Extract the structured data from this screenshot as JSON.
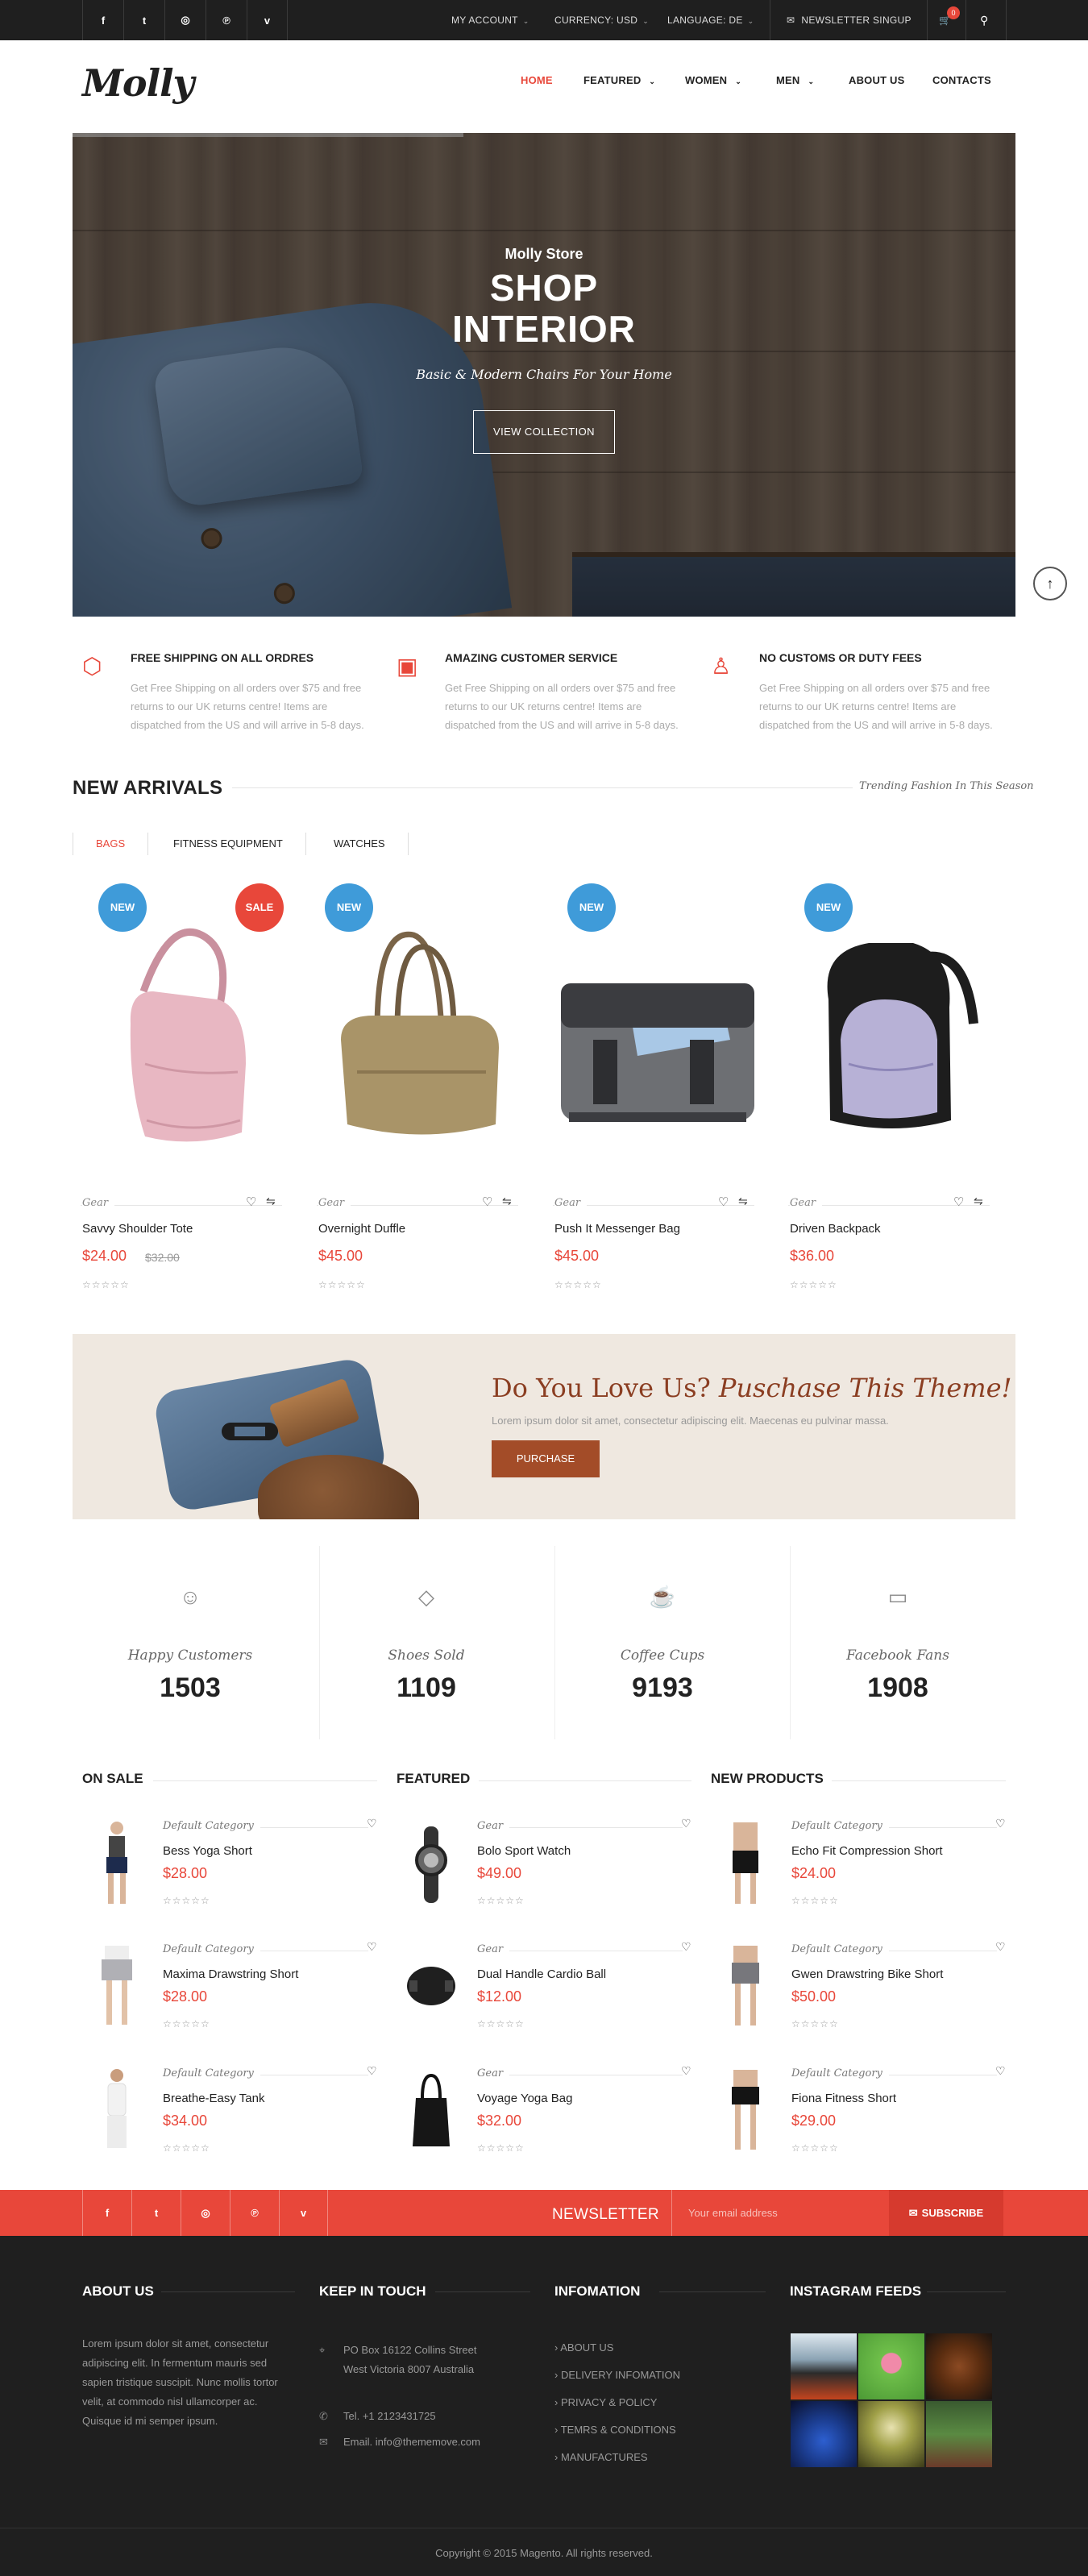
{
  "topbar": {
    "social": [
      "f",
      "t",
      "◎",
      "℗",
      "v"
    ],
    "account": "MY ACCOUNT",
    "currency": "CURRENCY: USD",
    "language": "LANGUAGE: DE",
    "newsletter": "NEWSLETTER SINGUP",
    "cart_count": "0"
  },
  "header": {
    "logo": "Molly",
    "nav": [
      "HOME",
      "FEATURED",
      "WOMEN",
      "MEN",
      "ABOUT US",
      "CONTACTS"
    ]
  },
  "hero": {
    "subtitle": "Molly Store",
    "title_line1": "SHOP",
    "title_line2": "INTERIOR",
    "tagline": "Basic & Modern Chairs For Your Home",
    "button": "VIEW COLLECTION"
  },
  "features": [
    {
      "title": "FREE SHIPPING ON ALL ORDRES",
      "desc": "Get Free Shipping on all orders over $75 and free returns to our UK returns centre! Items are dispatched from the US and will arrive in 5-8 days.",
      "icon": "box-icon"
    },
    {
      "title": "AMAZING CUSTOMER SERVICE",
      "desc": "Get Free Shipping on all orders over $75 and free returns to our UK returns centre! Items are dispatched from the US and will arrive in 5-8 days.",
      "icon": "wallet-icon"
    },
    {
      "title": "NO CUSTOMS OR DUTY FEES",
      "desc": "Get Free Shipping on all orders over $75 and free returns to our UK returns centre! Items are dispatched from the US and will arrive in 5-8 days.",
      "icon": "user-cancel-icon"
    }
  ],
  "new_arrivals": {
    "title": "NEW ARRIVALS",
    "trend": "Trending Fashion In This Season",
    "tabs": [
      "BAGS",
      "FITNESS EQUIPMENT",
      "WATCHES"
    ],
    "products": [
      {
        "badge": "NEW",
        "sale": "SALE",
        "category": "Gear",
        "name": "Savvy Shoulder Tote",
        "price": "$24.00",
        "old_price": "$32.00"
      },
      {
        "badge": "NEW",
        "category": "Gear",
        "name": "Overnight Duffle",
        "price": "$45.00"
      },
      {
        "badge": "NEW",
        "category": "Gear",
        "name": "Push It Messenger Bag",
        "price": "$45.00"
      },
      {
        "badge": "NEW",
        "category": "Gear",
        "name": "Driven Backpack",
        "price": "$36.00"
      }
    ],
    "stars": "☆☆☆☆☆"
  },
  "banner": {
    "title_a": "Do You Love Us?",
    "title_b": "Puschase This Theme!",
    "desc": "Lorem ipsum dolor sit amet, consectetur adipiscing elit. Maecenas eu pulvinar massa.",
    "button": "PURCHASE"
  },
  "stats": [
    {
      "label": "Happy Customers",
      "value": "1503",
      "icon": "☺"
    },
    {
      "label": "Shoes Sold",
      "value": "1109",
      "icon": "◇"
    },
    {
      "label": "Coffee Cups",
      "value": "9193",
      "icon": "☕"
    },
    {
      "label": "Facebook Fans",
      "value": "1908",
      "icon": "▭"
    }
  ],
  "lists": [
    {
      "title": "ON SALE",
      "items": [
        {
          "category": "Default Category",
          "name": "Bess Yoga Short",
          "price": "$28.00"
        },
        {
          "category": "Default Category",
          "name": "Maxima Drawstring Short",
          "price": "$28.00"
        },
        {
          "category": "Default Category",
          "name": "Breathe-Easy Tank",
          "price": "$34.00"
        }
      ]
    },
    {
      "title": "FEATURED",
      "items": [
        {
          "category": "Gear",
          "name": "Bolo Sport Watch",
          "price": "$49.00"
        },
        {
          "category": "Gear",
          "name": "Dual Handle Cardio Ball",
          "price": "$12.00"
        },
        {
          "category": "Gear",
          "name": "Voyage Yoga Bag",
          "price": "$32.00"
        }
      ]
    },
    {
      "title": "NEW PRODUCTS",
      "items": [
        {
          "category": "Default Category",
          "name": "Echo Fit Compression Short",
          "price": "$24.00"
        },
        {
          "category": "Default Category",
          "name": "Gwen Drawstring Bike Short",
          "price": "$50.00"
        },
        {
          "category": "Default Category",
          "name": "Fiona Fitness Short",
          "price": "$29.00"
        }
      ]
    }
  ],
  "newsletter": {
    "social": [
      "f",
      "t",
      "◎",
      "℗",
      "v"
    ],
    "title": "NEWSLETTER",
    "placeholder": "Your email address",
    "button": "SUBSCRIBE"
  },
  "footer": {
    "about_title": "ABOUT US",
    "about_text": "Lorem ipsum dolor sit amet, consectetur adipiscing elit. In fermentum mauris sed sapien tristique suscipit. Nunc mollis tortor velit, at commodo nisl ullamcorper ac. Quisque id mi semper ipsum.",
    "contact_title": "KEEP IN TOUCH",
    "address": "PO Box 16122 Collins Street West Victoria 8007 Australia",
    "phone": "Tel. +1 2123431725",
    "email": "Email. info@thememove.com",
    "info_title": "INFOMATION",
    "links": [
      "ABOUT US",
      "DELIVERY INFOMATION",
      "PRIVACY & POLICY",
      "TEMRS & CONDITIONS",
      "MANUFACTURES"
    ],
    "insta_title": "INSTAGRAM FEEDS",
    "copyright": "Copyright © 2015 Magento. All rights reserved."
  }
}
